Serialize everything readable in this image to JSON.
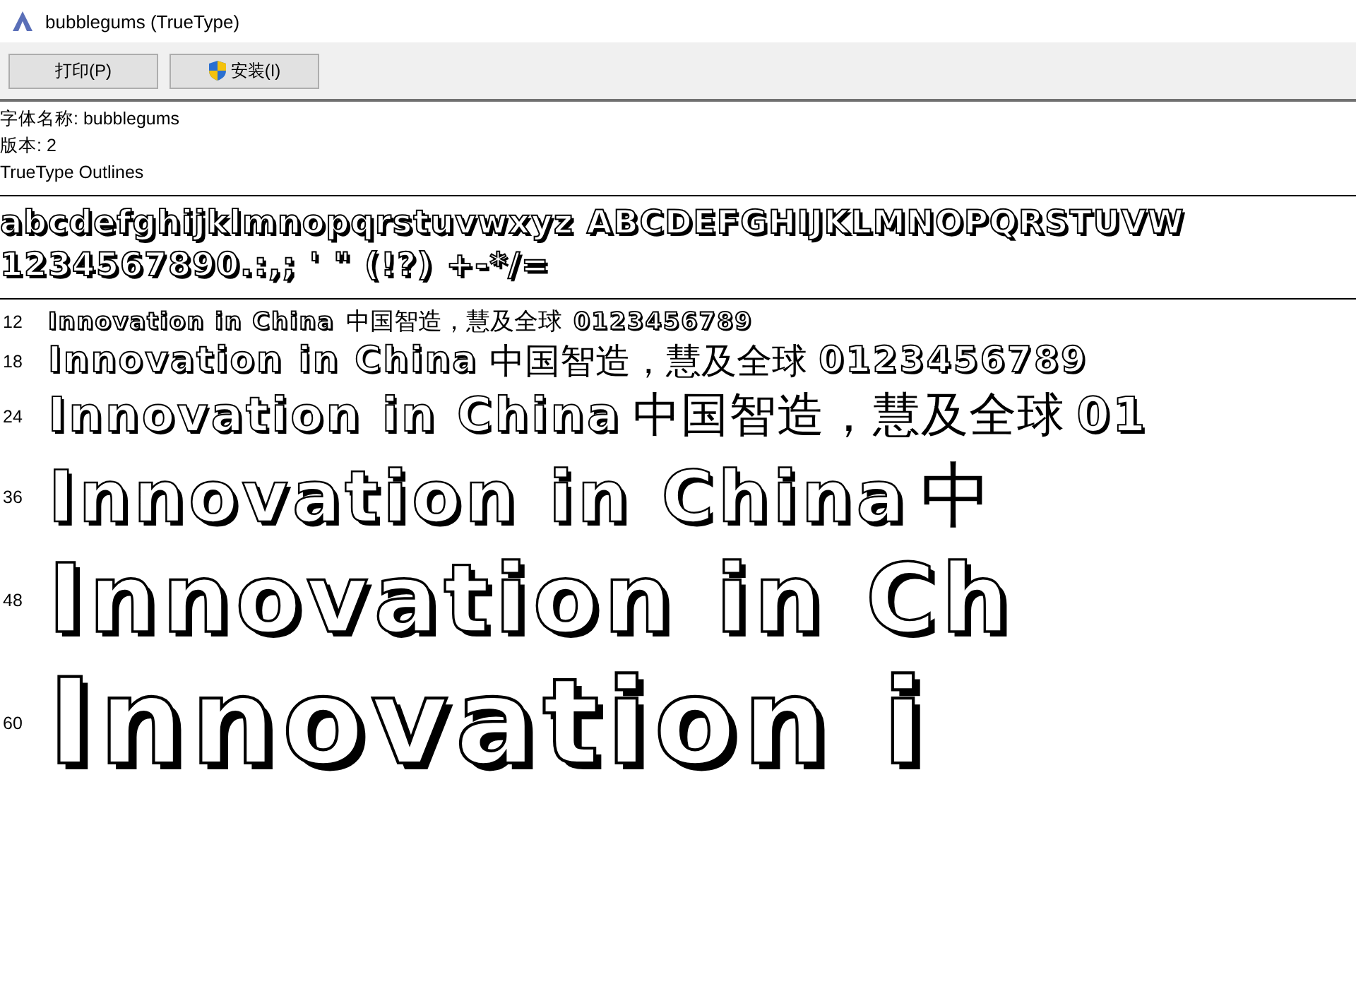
{
  "window": {
    "title": "bubblegums (TrueType)"
  },
  "buttons": [
    {
      "label": "打印(P)",
      "kind": "plain"
    },
    {
      "label": "安装(I)",
      "kind": "shield"
    }
  ],
  "info": [
    "字体名称: bubblegums",
    "版本: 2",
    "TrueType Outlines"
  ],
  "charset": [
    "abcdefghijklmnopqrstuvwxyz ABCDEFGHIJKLMNOPQRSTUVW",
    "1234567890.:,; ' \" (!?) +-*/="
  ],
  "samples": [
    {
      "size": "12",
      "latin": "Innovation in China",
      "cjk": "中国智造，慧及全球",
      "digits": "0123456789"
    },
    {
      "size": "18",
      "latin": "Innovation in China",
      "cjk": "中国智造，慧及全球",
      "digits": "0123456789"
    },
    {
      "size": "24",
      "latin": "Innovation in China",
      "cjk": "中国智造，慧及全球",
      "digits": "01"
    },
    {
      "size": "36",
      "latin": "Innovation in China",
      "cjk": "中"
    },
    {
      "size": "48",
      "latin": "Innovation in Ch"
    },
    {
      "size": "60",
      "latin": "Innovation i"
    }
  ]
}
